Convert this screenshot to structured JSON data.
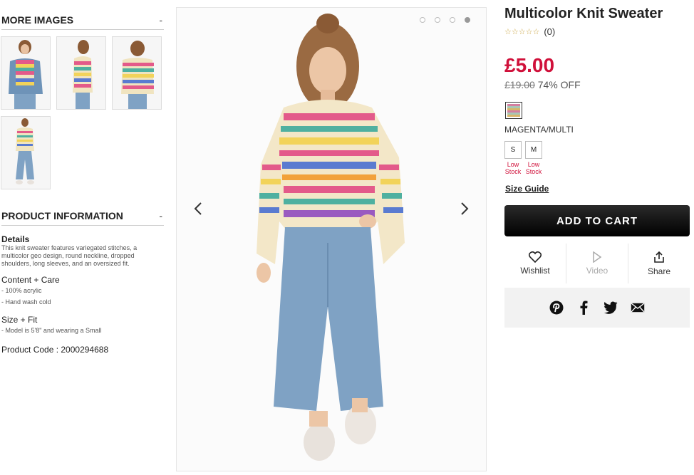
{
  "more_images": {
    "title": "MORE IMAGES",
    "toggle": "-"
  },
  "product_information": {
    "title": "PRODUCT INFORMATION",
    "toggle": "-",
    "details_title": "Details",
    "details_text": "This knit sweater features variegated stitches, a multicolor geo design, round neckline, dropped shoulders, long sleeves, and an oversized fit.",
    "content_title": "Content + Care",
    "content_items": [
      "- 100% acrylic",
      "- Hand wash cold"
    ],
    "size_title": "Size + Fit",
    "size_items": [
      "- Model is 5'8\" and wearing a Small"
    ],
    "code": "Product Code : 2000294688"
  },
  "carousel": {
    "total_dots": 4,
    "active_dot": 4
  },
  "product": {
    "title": "Multicolor Knit Sweater",
    "rating_count": "(0)",
    "stars": "☆☆☆☆☆",
    "price": "£5.00",
    "original_price": "£19.00",
    "discount": "74% OFF",
    "color_name": "MAGENTA/MULTI",
    "sizes": [
      {
        "label": "S",
        "stock": "Low Stock"
      },
      {
        "label": "M",
        "stock": "Low Stock"
      }
    ],
    "size_guide": "Size Guide",
    "add_to_cart": "ADD TO CART",
    "actions": {
      "wishlist": "Wishlist",
      "video": "Video",
      "share": "Share"
    }
  },
  "colors": {
    "price_red": "#d0103a",
    "button_black": "#000000"
  }
}
